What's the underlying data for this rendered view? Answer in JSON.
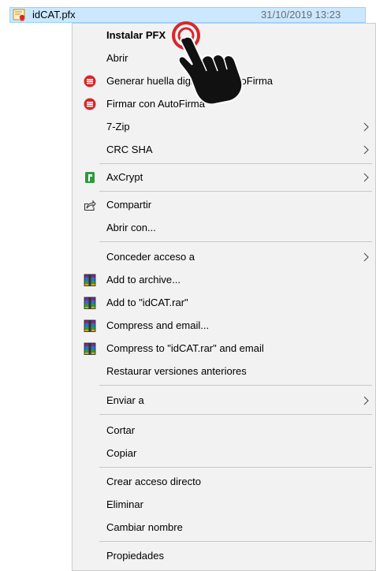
{
  "file": {
    "name": "idCAT.pfx",
    "date": "31/10/2019 13:23"
  },
  "menu": {
    "items": [
      {
        "label": "Instalar PFX"
      },
      {
        "label": "Abrir"
      },
      {
        "label": "Generar huella digital con AutoFirma",
        "icon": "autofirma-icon"
      },
      {
        "label": "Firmar con AutoFirma",
        "icon": "autofirma-icon"
      },
      {
        "label": "7-Zip",
        "submenu": true
      },
      {
        "label": "CRC SHA",
        "submenu": true
      },
      {
        "label": "AxCrypt",
        "icon": "axcrypt-icon",
        "submenu": true
      },
      {
        "label": "Compartir",
        "icon": "share-icon"
      },
      {
        "label": "Abrir con..."
      },
      {
        "label": "Conceder acceso a",
        "submenu": true
      },
      {
        "label": "Add to archive...",
        "icon": "winrar-icon"
      },
      {
        "label": "Add to \"idCAT.rar\"",
        "icon": "winrar-icon"
      },
      {
        "label": "Compress and email...",
        "icon": "winrar-icon"
      },
      {
        "label": "Compress to \"idCAT.rar\" and email",
        "icon": "winrar-icon"
      },
      {
        "label": "Restaurar versiones anteriores"
      },
      {
        "label": "Enviar a",
        "submenu": true
      },
      {
        "label": "Cortar"
      },
      {
        "label": "Copiar"
      },
      {
        "label": "Crear acceso directo"
      },
      {
        "label": "Eliminar"
      },
      {
        "label": "Cambiar nombre"
      },
      {
        "label": "Propiedades"
      }
    ]
  },
  "colors": {
    "selection": "#cce8ff",
    "menu_background": "#f2f2f2",
    "autofirma_red": "#d9262b",
    "axcrypt_green": "#2e9a3e",
    "click_indicator": "#d9262b"
  }
}
